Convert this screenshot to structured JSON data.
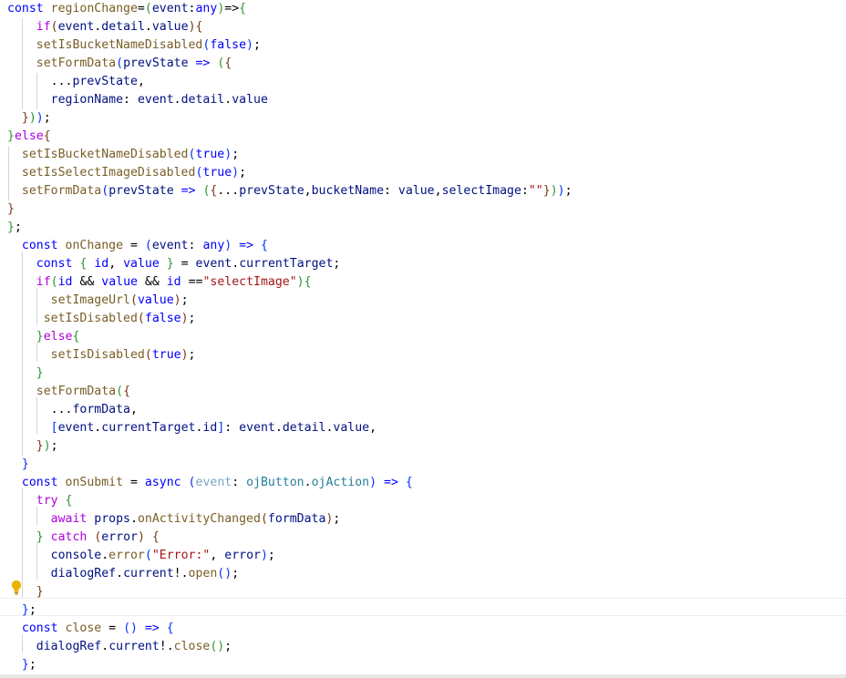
{
  "colors": {
    "keyword": "#0000ff",
    "control": "#af00db",
    "function": "#795e26",
    "variable": "#001080",
    "string": "#a31515",
    "type": "#267f99",
    "plain": "#000000",
    "bracket1": "#0431fa",
    "bracket2": "#319331",
    "bracket3": "#7b3814",
    "faded": "#7aa5c2"
  },
  "editor": {
    "lines": [
      [
        [
          "k",
          "const "
        ],
        [
          "f",
          "regionChange"
        ],
        [
          "p",
          "="
        ],
        [
          "b2",
          "("
        ],
        [
          "v",
          "event"
        ],
        [
          "p",
          ":"
        ],
        [
          "k",
          "any"
        ],
        [
          "b2",
          ")"
        ],
        [
          "p",
          "=>"
        ],
        [
          "b2",
          "{"
        ]
      ],
      [
        [
          "p",
          "    "
        ],
        [
          "c",
          "if"
        ],
        [
          "b3",
          "("
        ],
        [
          "v",
          "event"
        ],
        [
          "p",
          "."
        ],
        [
          "v",
          "detail"
        ],
        [
          "p",
          "."
        ],
        [
          "v",
          "value"
        ],
        [
          "b3",
          ")"
        ],
        [
          "b3",
          "{"
        ]
      ],
      [
        [
          "p",
          "    "
        ],
        [
          "f",
          "setIsBucketNameDisabled"
        ],
        [
          "b1",
          "("
        ],
        [
          "k",
          "false"
        ],
        [
          "b1",
          ")"
        ],
        [
          "p",
          ";"
        ]
      ],
      [
        [
          "p",
          "    "
        ],
        [
          "f",
          "setFormData"
        ],
        [
          "b1",
          "("
        ],
        [
          "v",
          "prevState"
        ],
        [
          "p",
          " "
        ],
        [
          "k",
          "=>"
        ],
        [
          "p",
          " "
        ],
        [
          "b2",
          "("
        ],
        [
          "b3",
          "{"
        ]
      ],
      [
        [
          "p",
          "      ..."
        ],
        [
          "v",
          "prevState"
        ],
        [
          "p",
          ","
        ]
      ],
      [
        [
          "p",
          "      "
        ],
        [
          "v",
          "regionName"
        ],
        [
          "p",
          ": "
        ],
        [
          "v",
          "event"
        ],
        [
          "p",
          "."
        ],
        [
          "v",
          "detail"
        ],
        [
          "p",
          "."
        ],
        [
          "v",
          "value"
        ]
      ],
      [
        [
          "p",
          "  "
        ],
        [
          "b3",
          "}"
        ],
        [
          "b2",
          ")"
        ],
        [
          "b1",
          ")"
        ],
        [
          "p",
          ";"
        ]
      ],
      [
        [
          "b2",
          "}"
        ],
        [
          "c",
          "else"
        ],
        [
          "b3",
          "{"
        ]
      ],
      [
        [
          "p",
          "  "
        ],
        [
          "f",
          "setIsBucketNameDisabled"
        ],
        [
          "b1",
          "("
        ],
        [
          "k",
          "true"
        ],
        [
          "b1",
          ")"
        ],
        [
          "p",
          ";"
        ]
      ],
      [
        [
          "p",
          "  "
        ],
        [
          "f",
          "setIsSelectImageDisabled"
        ],
        [
          "b1",
          "("
        ],
        [
          "k",
          "true"
        ],
        [
          "b1",
          ")"
        ],
        [
          "p",
          ";"
        ]
      ],
      [
        [
          "p",
          "  "
        ],
        [
          "f",
          "setFormData"
        ],
        [
          "b1",
          "("
        ],
        [
          "v",
          "prevState"
        ],
        [
          "p",
          " "
        ],
        [
          "k",
          "=>"
        ],
        [
          "p",
          " "
        ],
        [
          "b2",
          "("
        ],
        [
          "b3",
          "{"
        ],
        [
          "p",
          "..."
        ],
        [
          "v",
          "prevState"
        ],
        [
          "p",
          ","
        ],
        [
          "v",
          "bucketName"
        ],
        [
          "p",
          ": "
        ],
        [
          "v",
          "value"
        ],
        [
          "p",
          ","
        ],
        [
          "v",
          "selectImage"
        ],
        [
          "p",
          ":"
        ],
        [
          "s",
          "\"\""
        ],
        [
          "b3",
          "}"
        ],
        [
          "b2",
          ")"
        ],
        [
          "b1",
          ")"
        ],
        [
          "p",
          ";"
        ]
      ],
      [
        [
          "b3",
          "}"
        ]
      ],
      [
        [
          "b2",
          "}"
        ],
        [
          "p",
          ";"
        ]
      ],
      [
        [
          "p",
          "  "
        ],
        [
          "k",
          "const "
        ],
        [
          "f",
          "onChange"
        ],
        [
          "p",
          " = "
        ],
        [
          "b1",
          "("
        ],
        [
          "v",
          "event"
        ],
        [
          "p",
          ": "
        ],
        [
          "k",
          "any"
        ],
        [
          "b1",
          ")"
        ],
        [
          "p",
          " "
        ],
        [
          "k",
          "=>"
        ],
        [
          "p",
          " "
        ],
        [
          "b1",
          "{"
        ]
      ],
      [
        [
          "p",
          "    "
        ],
        [
          "k",
          "const "
        ],
        [
          "b2",
          "{"
        ],
        [
          "p",
          " "
        ],
        [
          "k",
          "id"
        ],
        [
          "p",
          ", "
        ],
        [
          "k",
          "value"
        ],
        [
          "p",
          " "
        ],
        [
          "b2",
          "}"
        ],
        [
          "p",
          " = "
        ],
        [
          "v",
          "event"
        ],
        [
          "p",
          "."
        ],
        [
          "v",
          "currentTarget"
        ],
        [
          "p",
          ";"
        ]
      ],
      [
        [
          "p",
          "    "
        ],
        [
          "c",
          "if"
        ],
        [
          "b2",
          "("
        ],
        [
          "k",
          "id"
        ],
        [
          "p",
          " && "
        ],
        [
          "k",
          "value"
        ],
        [
          "p",
          " && "
        ],
        [
          "k",
          "id"
        ],
        [
          "p",
          " =="
        ],
        [
          "s",
          "\"selectImage\""
        ],
        [
          "b2",
          ")"
        ],
        [
          "b2",
          "{"
        ]
      ],
      [
        [
          "p",
          "      "
        ],
        [
          "f",
          "setImageUrl"
        ],
        [
          "b3",
          "("
        ],
        [
          "k",
          "value"
        ],
        [
          "b3",
          ")"
        ],
        [
          "p",
          ";"
        ]
      ],
      [
        [
          "p",
          "     "
        ],
        [
          "f",
          "setIsDisabled"
        ],
        [
          "b3",
          "("
        ],
        [
          "k",
          "false"
        ],
        [
          "b3",
          ")"
        ],
        [
          "p",
          ";"
        ]
      ],
      [
        [
          "p",
          "    "
        ],
        [
          "b2",
          "}"
        ],
        [
          "c",
          "else"
        ],
        [
          "b2",
          "{"
        ]
      ],
      [
        [
          "p",
          "      "
        ],
        [
          "f",
          "setIsDisabled"
        ],
        [
          "b3",
          "("
        ],
        [
          "k",
          "true"
        ],
        [
          "b3",
          ")"
        ],
        [
          "p",
          ";"
        ]
      ],
      [
        [
          "p",
          "    "
        ],
        [
          "b2",
          "}"
        ]
      ],
      [
        [
          "p",
          "    "
        ],
        [
          "f",
          "setFormData"
        ],
        [
          "b2",
          "("
        ],
        [
          "b3",
          "{"
        ]
      ],
      [
        [
          "p",
          "      ..."
        ],
        [
          "v",
          "formData"
        ],
        [
          "p",
          ","
        ]
      ],
      [
        [
          "p",
          "      "
        ],
        [
          "b1",
          "["
        ],
        [
          "v",
          "event"
        ],
        [
          "p",
          "."
        ],
        [
          "v",
          "currentTarget"
        ],
        [
          "p",
          "."
        ],
        [
          "v",
          "id"
        ],
        [
          "b1",
          "]"
        ],
        [
          "p",
          ": "
        ],
        [
          "v",
          "event"
        ],
        [
          "p",
          "."
        ],
        [
          "v",
          "detail"
        ],
        [
          "p",
          "."
        ],
        [
          "v",
          "value"
        ],
        [
          "p",
          ","
        ]
      ],
      [
        [
          "p",
          "    "
        ],
        [
          "b3",
          "}"
        ],
        [
          "b2",
          ")"
        ],
        [
          "p",
          ";"
        ]
      ],
      [
        [
          "p",
          "  "
        ],
        [
          "b1",
          "}"
        ]
      ],
      [
        [
          "p",
          "  "
        ],
        [
          "k",
          "const "
        ],
        [
          "f",
          "onSubmit"
        ],
        [
          "p",
          " = "
        ],
        [
          "k",
          "async"
        ],
        [
          "p",
          " "
        ],
        [
          "b1",
          "("
        ],
        [
          "fa",
          "event"
        ],
        [
          "p",
          ": "
        ],
        [
          "t",
          "ojButton"
        ],
        [
          "p",
          "."
        ],
        [
          "t",
          "ojAction"
        ],
        [
          "b1",
          ")"
        ],
        [
          "p",
          " "
        ],
        [
          "k",
          "=>"
        ],
        [
          "p",
          " "
        ],
        [
          "b1",
          "{"
        ]
      ],
      [
        [
          "p",
          "    "
        ],
        [
          "c",
          "try"
        ],
        [
          "p",
          " "
        ],
        [
          "b2",
          "{"
        ]
      ],
      [
        [
          "p",
          "      "
        ],
        [
          "c",
          "await"
        ],
        [
          "p",
          " "
        ],
        [
          "v",
          "props"
        ],
        [
          "p",
          "."
        ],
        [
          "f",
          "onActivityChanged"
        ],
        [
          "b3",
          "("
        ],
        [
          "v",
          "formData"
        ],
        [
          "b3",
          ")"
        ],
        [
          "p",
          ";"
        ]
      ],
      [
        [
          "p",
          "    "
        ],
        [
          "b2",
          "}"
        ],
        [
          "p",
          " "
        ],
        [
          "c",
          "catch"
        ],
        [
          "p",
          " "
        ],
        [
          "b3",
          "("
        ],
        [
          "v",
          "error"
        ],
        [
          "b3",
          ")"
        ],
        [
          "p",
          " "
        ],
        [
          "b3",
          "{"
        ]
      ],
      [
        [
          "p",
          "      "
        ],
        [
          "v",
          "console"
        ],
        [
          "p",
          "."
        ],
        [
          "f",
          "error"
        ],
        [
          "b1",
          "("
        ],
        [
          "s",
          "\"Error:\""
        ],
        [
          "p",
          ", "
        ],
        [
          "v",
          "error"
        ],
        [
          "b1",
          ")"
        ],
        [
          "p",
          ";"
        ]
      ],
      [
        [
          "p",
          "      "
        ],
        [
          "v",
          "dialogRef"
        ],
        [
          "p",
          "."
        ],
        [
          "v",
          "current"
        ],
        [
          "p",
          "!."
        ],
        [
          "f",
          "open"
        ],
        [
          "b1",
          "()"
        ],
        [
          "p",
          ";"
        ]
      ],
      [
        [
          "p",
          "    "
        ],
        [
          "b3",
          "}"
        ]
      ],
      [
        [
          "p",
          "  "
        ],
        [
          "b1",
          "}"
        ],
        [
          "p",
          ";"
        ]
      ],
      [
        [
          "p",
          "  "
        ],
        [
          "k",
          "const "
        ],
        [
          "f",
          "close"
        ],
        [
          "p",
          " = "
        ],
        [
          "b1",
          "()"
        ],
        [
          "p",
          " "
        ],
        [
          "k",
          "=>"
        ],
        [
          "p",
          " "
        ],
        [
          "b1",
          "{"
        ]
      ],
      [
        [
          "p",
          "    "
        ],
        [
          "v",
          "dialogRef"
        ],
        [
          "p",
          "."
        ],
        [
          "v",
          "current"
        ],
        [
          "p",
          "!."
        ],
        [
          "f",
          "close"
        ],
        [
          "b2",
          "()"
        ],
        [
          "p",
          ";"
        ]
      ],
      [
        [
          "p",
          "  "
        ],
        [
          "b1",
          "}"
        ],
        [
          "p",
          ";"
        ]
      ]
    ]
  },
  "lightbulb": {
    "icon": "lightbulb-icon"
  }
}
